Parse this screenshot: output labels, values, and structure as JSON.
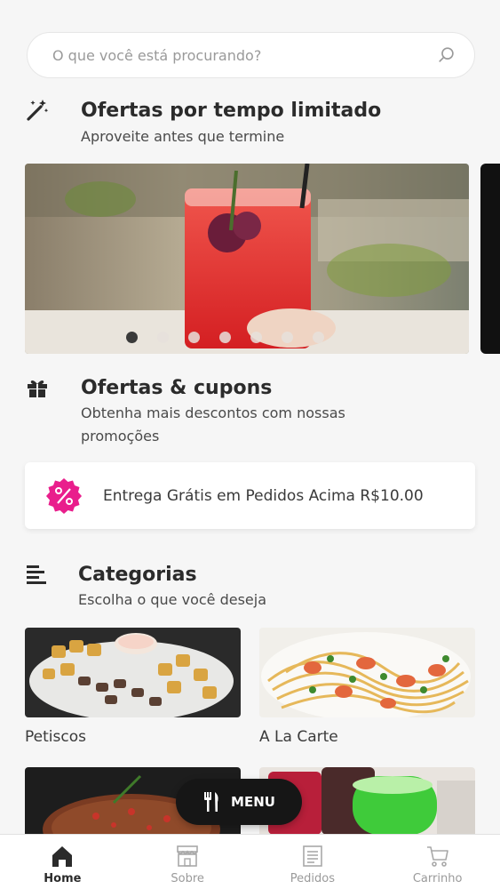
{
  "search": {
    "placeholder": "O que você está procurando?",
    "icon": "search-icon"
  },
  "limited_offers": {
    "icon": "magic-wand-icon",
    "title": "Ofertas por tempo limitado",
    "subtitle": "Aproveite antes que termine",
    "carousel": {
      "slide_count": 7,
      "active_index": 0
    }
  },
  "coupons": {
    "icon": "gift-icon",
    "title": "Ofertas & cupons",
    "subtitle": "Obtenha mais descontos com nossas promoções",
    "items": [
      {
        "badge_icon": "percent-badge-icon",
        "text": "Entrega Grátis em Pedidos Acima R$10.00",
        "badge_color": "#e91e8c"
      }
    ]
  },
  "categories": {
    "icon": "list-icon",
    "title": "Categorias",
    "subtitle": "Escolha o que você deseja",
    "items": [
      {
        "label": "Petiscos"
      },
      {
        "label": "A La Carte"
      },
      {
        "label": ""
      },
      {
        "label": ""
      }
    ]
  },
  "menu_button": {
    "label": "MENU",
    "icon": "fork-knife-icon"
  },
  "tabbar": {
    "items": [
      {
        "label": "Home",
        "icon": "home-icon",
        "active": true
      },
      {
        "label": "Sobre",
        "icon": "store-icon",
        "active": false
      },
      {
        "label": "Pedidos",
        "icon": "orders-icon",
        "active": false
      },
      {
        "label": "Carrinho",
        "icon": "cart-icon",
        "active": false
      }
    ]
  }
}
